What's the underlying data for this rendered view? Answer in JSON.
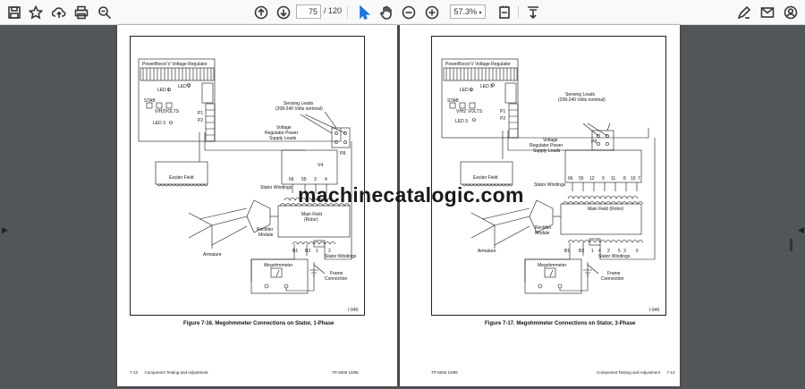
{
  "toolbar": {
    "icons": [
      "save-icon",
      "bookmark-star-icon",
      "upload-cloud-icon",
      "print-icon",
      "zoom-search-icon",
      "page-up-icon",
      "page-down-icon",
      "select-cursor-icon",
      "hand-pan-icon",
      "zoom-out-icon",
      "zoom-in-icon",
      "fit-page-icon",
      "download-icon",
      "sign-pen-icon",
      "email-icon",
      "account-icon"
    ],
    "page_current": "75",
    "page_total": "/ 120",
    "zoom": "57.3%"
  },
  "watermark": "machinecatalogic.com",
  "left_page": {
    "caption": "Figure 7-16. Megohmmeter Connections on Stator, 1-Phase",
    "id": "I-940",
    "footer_left": "7-12      Component Testing and Adjustment",
    "footer_right": "TP-5006 10/95",
    "labels": {
      "regulator": "PowerBoost V Voltage Regulator",
      "led1": "LED 1",
      "led2": "LED 2",
      "led3": "LED 3",
      "stab": "STAB",
      "vhz": "V/HZ",
      "volts": "VOLTS",
      "p1": "P1",
      "p2": "P2",
      "sensing": "Sensing Leads",
      "sensing2": "(208-240 Volts nominal)",
      "vr_power1": "Voltage",
      "vr_power2": "Regulator Power",
      "vr_power3": "Supply Leads",
      "p8": "P8",
      "v4": "V4",
      "n66": "66",
      "n55": "55",
      "n3": "3",
      "n4": "4",
      "exciter": "Exciter Field",
      "stator": "Stator Windings",
      "main1": "Main Field",
      "main2": "(Rotor)",
      "rect1": "Rectifier",
      "rect2": "Module",
      "armature": "Armature",
      "b1": "B1",
      "b2": "B2",
      "n1": "1",
      "n2": "2",
      "stator2": "Stator Windings",
      "megohm": "Megohmmeter",
      "frame1": "Frame",
      "frame2": "Connection"
    }
  },
  "right_page": {
    "caption": "Figure 7-17. Megohmmeter Connections on Stator, 3-Phase",
    "id": "I-940",
    "footer_left": "TP-5006 10/95",
    "footer_right": "Component Testing and Adjustment      7-13",
    "labels": {
      "regulator": "PowerBoost V Voltage Regulator",
      "led1": "LED 1",
      "led2": "LED 2",
      "led3": "LED 3",
      "stab": "STAB",
      "vhz": "V/HZ",
      "volts": "VOLTS",
      "p1": "P1",
      "p2": "P2",
      "sensing": "Sensing Leads",
      "sensing2": "(208-240 Volts nominal)",
      "vr_power1": "Voltage",
      "vr_power2": "Regulator Power",
      "vr_power3": "Supply Leads",
      "p8": "P8",
      "exciter": "Exciter Field",
      "stator": "Stator Windings",
      "n66": "66",
      "n55": "55",
      "n12": "12",
      "n9": "9",
      "n11": "11",
      "n8": "8",
      "n10": "10",
      "n7": "7",
      "main": "Main Field (Rotor)",
      "rect1": "Rectifier",
      "rect2": "Module",
      "armature": "Armature",
      "b1": "B1",
      "b2": "B2",
      "s1": "1",
      "s4": "4",
      "s2": "2",
      "s5": "5",
      "s3": "3",
      "s6": "6",
      "stator2": "Stator Windings",
      "megohm": "Megohmmeter",
      "frame1": "Frame",
      "frame2": "Connection"
    }
  }
}
